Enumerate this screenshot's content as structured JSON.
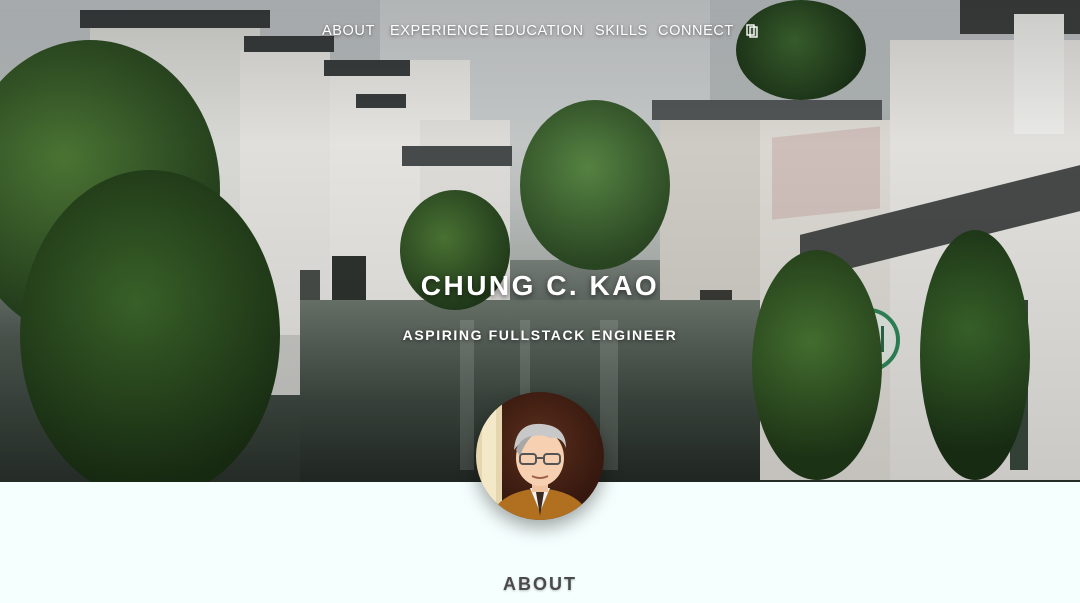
{
  "nav": {
    "items": [
      {
        "label": "ABOUT"
      },
      {
        "label": "EXPERIENCE"
      },
      {
        "label": "EDUCATION"
      },
      {
        "label": "SKILLS"
      },
      {
        "label": "CONNECT"
      }
    ],
    "extra_icon": "document-icon"
  },
  "hero": {
    "name": "CHUNG C. KAO",
    "tagline": "ASPIRING FULLSTACK ENGINEER",
    "background_description_icon": "canal-town-photo"
  },
  "about": {
    "heading": "ABOUT"
  },
  "colors": {
    "page_background": "#f5fffe",
    "hero_text": "#ffffff",
    "section_heading": "#4a4a4a"
  }
}
